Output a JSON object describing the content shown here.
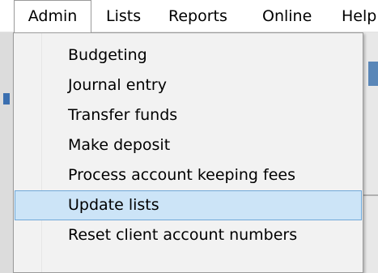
{
  "menubar": {
    "items": [
      {
        "label": "Admin"
      },
      {
        "label": "Lists"
      },
      {
        "label": "Reports"
      },
      {
        "label": "Online"
      },
      {
        "label": "Help"
      }
    ]
  },
  "admin_menu": {
    "items": [
      {
        "label": "Budgeting"
      },
      {
        "label": "Journal entry"
      },
      {
        "label": "Transfer funds"
      },
      {
        "label": "Make deposit"
      },
      {
        "label": "Process account keeping fees"
      },
      {
        "label": "Update lists",
        "highlighted": true
      },
      {
        "label": "Reset client account numbers"
      }
    ]
  },
  "colors": {
    "highlight_fill": "#cce4f7",
    "highlight_border": "#6fa8d8",
    "menu_background": "#f2f2f2"
  }
}
